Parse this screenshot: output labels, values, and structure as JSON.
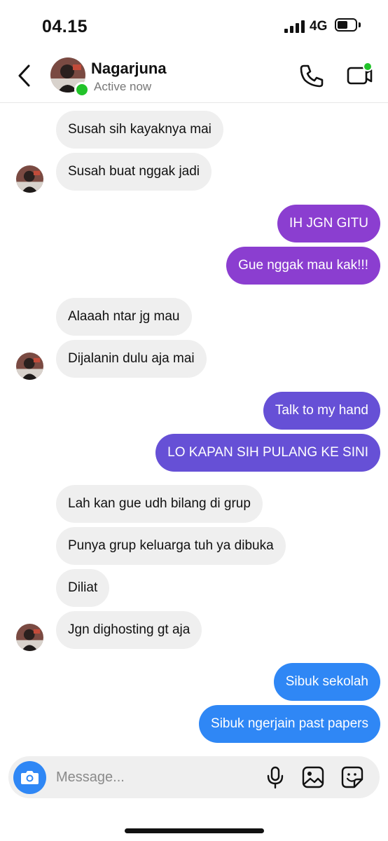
{
  "status_bar": {
    "time": "04.15",
    "network": "4G"
  },
  "header": {
    "contact_name": "Nagarjuna",
    "status": "Active now"
  },
  "colors": {
    "purple": "#8b3ed0",
    "violet": "#6650d6",
    "blue": "#2f87f5",
    "incoming": "#efefef",
    "online": "#22c32a"
  },
  "messages": [
    {
      "from": "them",
      "text": "Susah sih kayaknya mai"
    },
    {
      "from": "them",
      "text": "Susah buat nggak jadi"
    },
    {
      "from": "me",
      "text": "IH JGN GITU"
    },
    {
      "from": "me",
      "text": "Gue nggak mau kak!!!"
    },
    {
      "from": "them",
      "text": "Alaaah ntar jg mau"
    },
    {
      "from": "them",
      "text": "Dijalanin dulu aja mai"
    },
    {
      "from": "me",
      "text": "Talk to my hand"
    },
    {
      "from": "me",
      "text": "LO KAPAN SIH PULANG KE SINI"
    },
    {
      "from": "them",
      "text": "Lah kan gue udh bilang di grup"
    },
    {
      "from": "them",
      "text": "Punya grup keluarga tuh ya dibuka"
    },
    {
      "from": "them",
      "text": "Diliat"
    },
    {
      "from": "them",
      "text": "Jgn dighosting gt aja"
    },
    {
      "from": "me",
      "text": "Sibuk sekolah"
    },
    {
      "from": "me",
      "text": "Sibuk ngerjain past papers"
    }
  ],
  "composer": {
    "placeholder": "Message...",
    "icons": [
      "camera-icon",
      "microphone-icon",
      "gallery-icon",
      "sticker-icon"
    ]
  }
}
